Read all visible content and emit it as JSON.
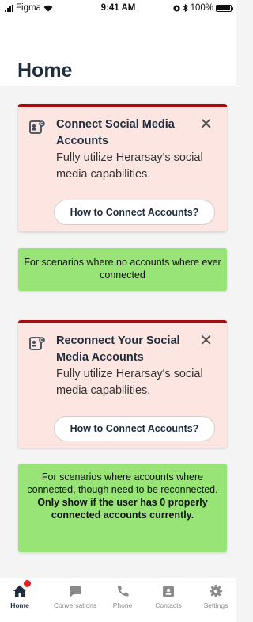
{
  "status_bar": {
    "carrier": "Figma",
    "time": "9:41 AM",
    "battery": "100%",
    "battery_level": 1.0
  },
  "header": {
    "title": "Home"
  },
  "cards": [
    {
      "title": "Connect Social Media Accounts",
      "text": "Fully utilize Herarsay's social media capabilities.",
      "button_label": "How to Connect Accounts?",
      "icon": "social-accounts-icon",
      "close_icon": "close-icon",
      "close_glyph": "✕"
    },
    {
      "title": "Reconnect Your Social Media Accounts",
      "text": "Fully utilize Herarsay's social media capabilities.",
      "button_label": "How to Connect Accounts?",
      "icon": "social-accounts-icon",
      "close_icon": "close-icon",
      "close_glyph": "✕"
    }
  ],
  "notes": [
    {
      "text": "For scenarios where no accounts where ever connected"
    },
    {
      "text": "For scenarios where accounts where connected, though need to be reconnected.",
      "bold_text": "Only show if the user has 0 properly connected accounts currently."
    }
  ],
  "tabbar": {
    "items": [
      {
        "label": "Home",
        "icon": "home-icon",
        "active": true,
        "badge": true
      },
      {
        "label": "Conversations",
        "icon": "chat-icon",
        "active": false
      },
      {
        "label": "Phone",
        "icon": "phone-icon",
        "active": false
      },
      {
        "label": "Contacts",
        "icon": "contacts-icon",
        "active": false
      },
      {
        "label": "Settings",
        "icon": "gear-icon",
        "active": false
      }
    ]
  },
  "colors": {
    "card_background": "#fde6e2",
    "card_accent": "#a50e0e",
    "note_background": "#98e476",
    "text_primary": "#1f2d3d",
    "badge": "#e02424"
  }
}
